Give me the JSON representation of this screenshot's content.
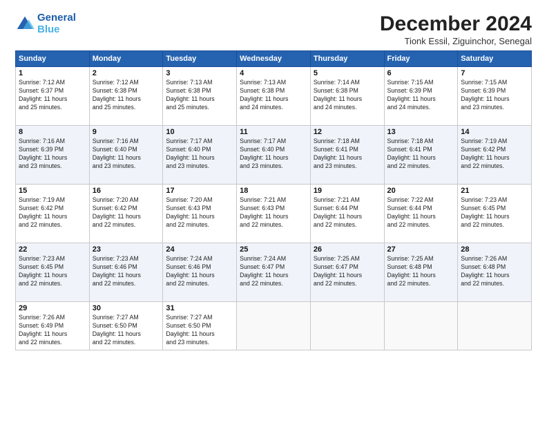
{
  "header": {
    "logo_line1": "General",
    "logo_line2": "Blue",
    "title": "December 2024",
    "location": "Tionk Essil, Ziguinchor, Senegal"
  },
  "weekdays": [
    "Sunday",
    "Monday",
    "Tuesday",
    "Wednesday",
    "Thursday",
    "Friday",
    "Saturday"
  ],
  "weeks": [
    [
      {
        "day": 1,
        "info": "Sunrise: 7:12 AM\nSunset: 6:37 PM\nDaylight: 11 hours\nand 25 minutes."
      },
      {
        "day": 2,
        "info": "Sunrise: 7:12 AM\nSunset: 6:38 PM\nDaylight: 11 hours\nand 25 minutes."
      },
      {
        "day": 3,
        "info": "Sunrise: 7:13 AM\nSunset: 6:38 PM\nDaylight: 11 hours\nand 25 minutes."
      },
      {
        "day": 4,
        "info": "Sunrise: 7:13 AM\nSunset: 6:38 PM\nDaylight: 11 hours\nand 24 minutes."
      },
      {
        "day": 5,
        "info": "Sunrise: 7:14 AM\nSunset: 6:38 PM\nDaylight: 11 hours\nand 24 minutes."
      },
      {
        "day": 6,
        "info": "Sunrise: 7:15 AM\nSunset: 6:39 PM\nDaylight: 11 hours\nand 24 minutes."
      },
      {
        "day": 7,
        "info": "Sunrise: 7:15 AM\nSunset: 6:39 PM\nDaylight: 11 hours\nand 23 minutes."
      }
    ],
    [
      {
        "day": 8,
        "info": "Sunrise: 7:16 AM\nSunset: 6:39 PM\nDaylight: 11 hours\nand 23 minutes."
      },
      {
        "day": 9,
        "info": "Sunrise: 7:16 AM\nSunset: 6:40 PM\nDaylight: 11 hours\nand 23 minutes."
      },
      {
        "day": 10,
        "info": "Sunrise: 7:17 AM\nSunset: 6:40 PM\nDaylight: 11 hours\nand 23 minutes."
      },
      {
        "day": 11,
        "info": "Sunrise: 7:17 AM\nSunset: 6:40 PM\nDaylight: 11 hours\nand 23 minutes."
      },
      {
        "day": 12,
        "info": "Sunrise: 7:18 AM\nSunset: 6:41 PM\nDaylight: 11 hours\nand 23 minutes."
      },
      {
        "day": 13,
        "info": "Sunrise: 7:18 AM\nSunset: 6:41 PM\nDaylight: 11 hours\nand 22 minutes."
      },
      {
        "day": 14,
        "info": "Sunrise: 7:19 AM\nSunset: 6:42 PM\nDaylight: 11 hours\nand 22 minutes."
      }
    ],
    [
      {
        "day": 15,
        "info": "Sunrise: 7:19 AM\nSunset: 6:42 PM\nDaylight: 11 hours\nand 22 minutes."
      },
      {
        "day": 16,
        "info": "Sunrise: 7:20 AM\nSunset: 6:42 PM\nDaylight: 11 hours\nand 22 minutes."
      },
      {
        "day": 17,
        "info": "Sunrise: 7:20 AM\nSunset: 6:43 PM\nDaylight: 11 hours\nand 22 minutes."
      },
      {
        "day": 18,
        "info": "Sunrise: 7:21 AM\nSunset: 6:43 PM\nDaylight: 11 hours\nand 22 minutes."
      },
      {
        "day": 19,
        "info": "Sunrise: 7:21 AM\nSunset: 6:44 PM\nDaylight: 11 hours\nand 22 minutes."
      },
      {
        "day": 20,
        "info": "Sunrise: 7:22 AM\nSunset: 6:44 PM\nDaylight: 11 hours\nand 22 minutes."
      },
      {
        "day": 21,
        "info": "Sunrise: 7:23 AM\nSunset: 6:45 PM\nDaylight: 11 hours\nand 22 minutes."
      }
    ],
    [
      {
        "day": 22,
        "info": "Sunrise: 7:23 AM\nSunset: 6:45 PM\nDaylight: 11 hours\nand 22 minutes."
      },
      {
        "day": 23,
        "info": "Sunrise: 7:23 AM\nSunset: 6:46 PM\nDaylight: 11 hours\nand 22 minutes."
      },
      {
        "day": 24,
        "info": "Sunrise: 7:24 AM\nSunset: 6:46 PM\nDaylight: 11 hours\nand 22 minutes."
      },
      {
        "day": 25,
        "info": "Sunrise: 7:24 AM\nSunset: 6:47 PM\nDaylight: 11 hours\nand 22 minutes."
      },
      {
        "day": 26,
        "info": "Sunrise: 7:25 AM\nSunset: 6:47 PM\nDaylight: 11 hours\nand 22 minutes."
      },
      {
        "day": 27,
        "info": "Sunrise: 7:25 AM\nSunset: 6:48 PM\nDaylight: 11 hours\nand 22 minutes."
      },
      {
        "day": 28,
        "info": "Sunrise: 7:26 AM\nSunset: 6:48 PM\nDaylight: 11 hours\nand 22 minutes."
      }
    ],
    [
      {
        "day": 29,
        "info": "Sunrise: 7:26 AM\nSunset: 6:49 PM\nDaylight: 11 hours\nand 22 minutes."
      },
      {
        "day": 30,
        "info": "Sunrise: 7:27 AM\nSunset: 6:50 PM\nDaylight: 11 hours\nand 22 minutes."
      },
      {
        "day": 31,
        "info": "Sunrise: 7:27 AM\nSunset: 6:50 PM\nDaylight: 11 hours\nand 23 minutes."
      },
      null,
      null,
      null,
      null
    ]
  ]
}
